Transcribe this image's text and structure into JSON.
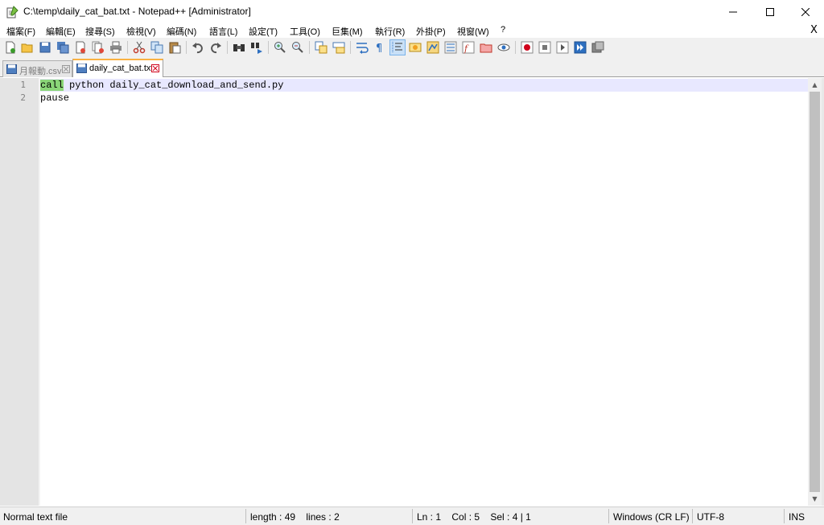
{
  "window": {
    "title": "C:\\temp\\daily_cat_bat.txt - Notepad++ [Administrator]",
    "controls": {
      "minimize": "—",
      "maximize": "☐",
      "close": "✕"
    }
  },
  "menu": {
    "items": [
      "檔案(F)",
      "編輯(E)",
      "搜尋(S)",
      "檢視(V)",
      "編碼(N)",
      "語言(L)",
      "設定(T)",
      "工具(O)",
      "巨集(M)",
      "執行(R)",
      "外掛(P)",
      "視窗(W)",
      "?"
    ],
    "close_doc": "X"
  },
  "toolbar": {
    "icons": [
      "new-file-icon",
      "open-file-icon",
      "save-icon",
      "save-all-icon",
      "close-icon",
      "close-all-icon",
      "print-icon",
      "cut-icon",
      "copy-icon",
      "paste-icon",
      "undo-icon",
      "redo-icon",
      "find-icon",
      "replace-icon",
      "zoom-in-icon",
      "zoom-out-icon",
      "sync-vertical-icon",
      "sync-horizontal-icon",
      "word-wrap-icon",
      "show-all-chars-icon",
      "indent-guide-icon",
      "udl-icon",
      "doc-map-icon",
      "function-list-icon",
      "folder-workspace-icon",
      "monitor-icon",
      "record-macro-icon",
      "stop-macro-icon",
      "play-macro-icon",
      "run-multiple-macro-icon",
      "save-macro-icon"
    ]
  },
  "tabs": [
    {
      "label": "月報動.csv",
      "active": false
    },
    {
      "label": "daily_cat_bat.txt",
      "active": true
    }
  ],
  "editor": {
    "lines": [
      {
        "number": "1",
        "highlight": "call",
        "rest": " python daily_cat_download_and_send.py"
      },
      {
        "number": "2",
        "highlight": "",
        "rest": "pause"
      }
    ]
  },
  "status": {
    "file_type": "Normal text file",
    "length_lines": "length : 49    lines : 2",
    "position": "Ln : 1    Col : 5    Sel : 4 | 1",
    "eol": "Windows (CR LF)",
    "encoding": "UTF-8",
    "mode": "INS"
  },
  "colors": {
    "active_tab_accent": "#fab142",
    "current_line": "#e8e8ff",
    "match_highlight": "#8ad678"
  }
}
